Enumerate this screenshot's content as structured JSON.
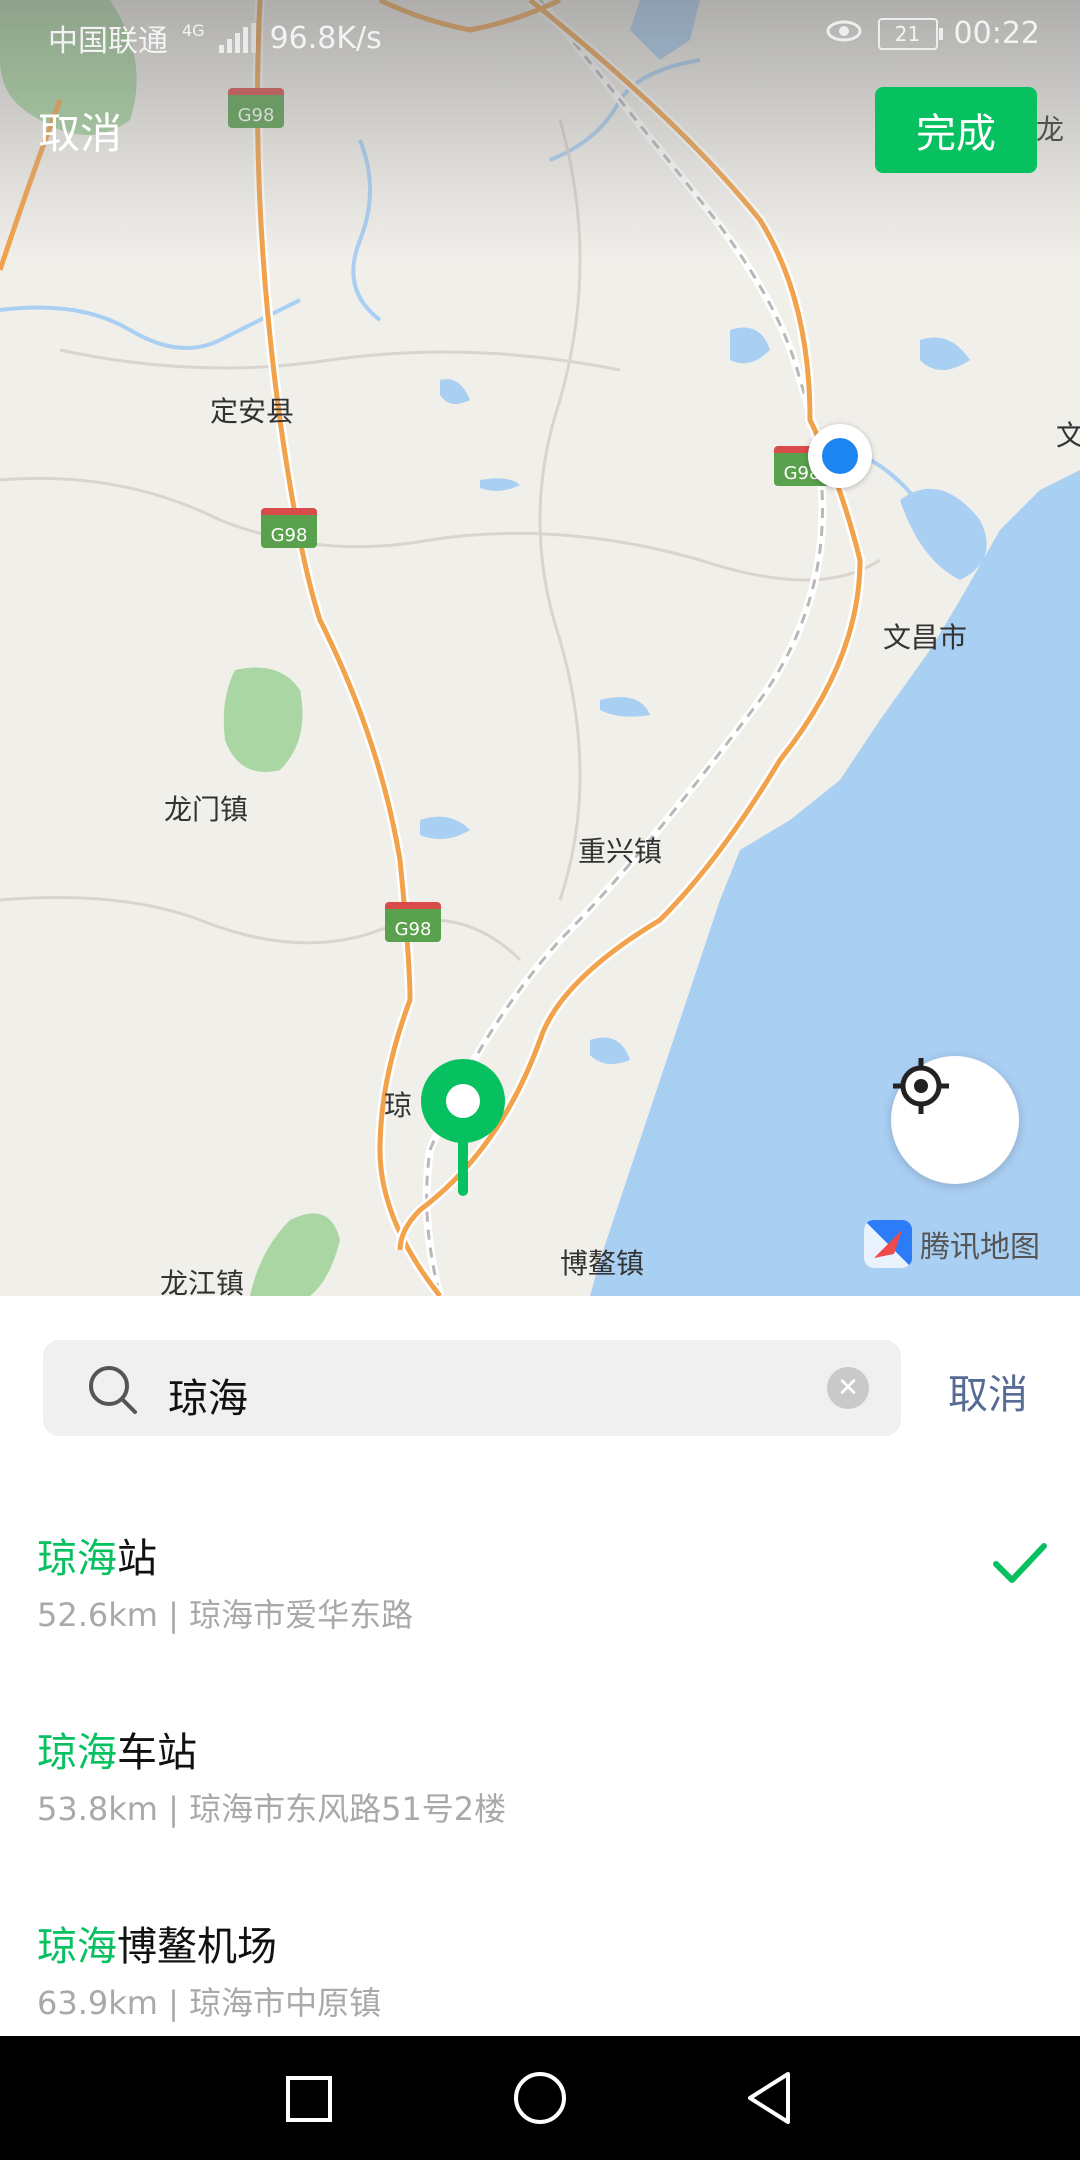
{
  "status_bar": {
    "carrier": "中国联通",
    "network": "4G",
    "speed": "96.8K/s",
    "battery": "21",
    "time": "00:22"
  },
  "header": {
    "cancel_label": "取消",
    "done_label": "完成"
  },
  "map": {
    "labels": {
      "dingan": "定安县",
      "longmen": "龙门镇",
      "chongxing": "重兴镇",
      "wenchang": "文昌市",
      "bo_ao": "博鳌镇",
      "longjiang": "龙江镇",
      "qiong": "琼",
      "long_edge": "龙",
      "wen_edge": "文"
    },
    "highway": "G98",
    "brand": "腾讯地图"
  },
  "search": {
    "query": "琼海",
    "cancel_label": "取消"
  },
  "results": [
    {
      "highlight": "琼海",
      "title_rest": "站",
      "distance": "52.6km",
      "address": "琼海市爱华东路",
      "selected": true
    },
    {
      "highlight": "琼海",
      "title_rest": "车站",
      "distance": "53.8km",
      "address": "琼海市东风路51号2楼",
      "selected": false
    },
    {
      "highlight": "琼海",
      "title_rest": "博鳌机场",
      "distance": "63.9km",
      "address": "琼海市中原镇",
      "selected": false
    }
  ],
  "colors": {
    "accent_green": "#07c160",
    "link_blue": "#576b95",
    "sea": "#a9cff3",
    "road": "#f2a24a"
  }
}
